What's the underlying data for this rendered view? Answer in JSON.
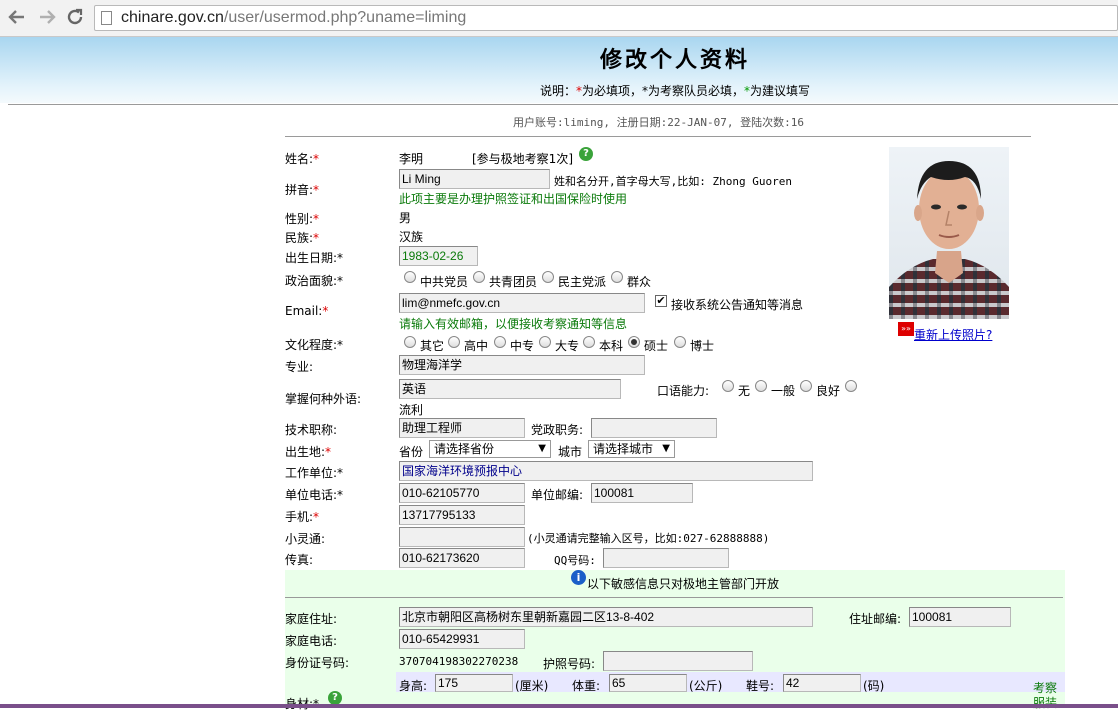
{
  "browser": {
    "url_host": "chinare.gov.cn",
    "url_path": "/user/usermod.php?uname=liming",
    "back_icon": "arrow-left-icon",
    "forward_icon": "arrow-right-icon",
    "reload_icon": "reload-icon"
  },
  "header": {
    "title": "修改个人资料",
    "legend_prefix": "说明：",
    "legend_req": "为必填项，",
    "legend_team": "为考察队员必填，",
    "legend_suggest": "为建议填写",
    "star": "*"
  },
  "account_info": "用户账号:liming, 注册日期:22-JAN-07, 登陆次数:16",
  "form": {
    "name_label": "姓名:",
    "name_value": "李明",
    "expedition": "[参与极地考察1次]",
    "pinyin_label": "拼音:",
    "pinyin_value": "Li Ming",
    "pinyin_hint": "姓和名分开,首字母大写,比如: Zhong Guoren",
    "pinyin_note": "此项主要是办理护照签证和出国保险时使用",
    "gender_label": "性别:",
    "gender_value": "男",
    "ethnic_label": "民族:",
    "ethnic_value": "汉族",
    "birth_label": "出生日期:",
    "birth_value": "1983-02-26",
    "political_label": "政治面貌:",
    "political_options": [
      "中共党员",
      "共青团员",
      "民主党派",
      "群众"
    ],
    "email_label": "Email:",
    "email_value": "lim@nmefc.gov.cn",
    "email_checkbox": "接收系统公告通知等消息",
    "email_note": "请输入有效邮箱，以便接收考察通知等信息",
    "edu_label": "文化程度:",
    "edu_options": [
      "其它",
      "高中",
      "中专",
      "大专",
      "本科",
      "硕士",
      "博士"
    ],
    "edu_selected": "硕士",
    "major_label": "专业:",
    "major_value": "物理海洋学",
    "lang_label": "掌握何种外语:",
    "lang_value": "英语",
    "oral_label": "口语能力:",
    "oral_options": [
      "无",
      "一般",
      "良好",
      "流利"
    ],
    "title_label": "技术职称:",
    "title_value": "助理工程师",
    "party_label": "党政职务:",
    "party_value": "",
    "birthplace_label": "出生地:",
    "province_label": "省份",
    "province_value": "请选择省份",
    "city_label": "城市",
    "city_value": "请选择城市",
    "work_label": "工作单位:",
    "work_value": "国家海洋环境预报中心",
    "workphone_label": "单位电话:",
    "workphone_value": "010-62105770",
    "workzip_label": "单位邮编:",
    "workzip_value": "100081",
    "mobile_label": "手机:",
    "mobile_value": "13717795133",
    "phs_label": "小灵通:",
    "phs_value": "",
    "phs_hint": "(小灵通请完整输入区号，比如:027-62888888)",
    "fax_label": "传真:",
    "fax_value": "010-62173620",
    "qq_label": "QQ号码:",
    "qq_value": "",
    "sensitive_note": "以下敏感信息只对极地主管部门开放",
    "home_label": "家庭住址:",
    "home_value": "北京市朝阳区高杨树东里朝新嘉园二区13-8-402",
    "homezip_label": "住址邮编:",
    "homezip_value": "100081",
    "homephone_label": "家庭电话:",
    "homephone_value": "010-65429931",
    "id_label": "身份证号码:",
    "id_value": "370704198302270238",
    "passport_label": "护照号码:",
    "passport_value": "",
    "body_label": "身材:",
    "height_label": "身高:",
    "height_value": "175",
    "height_unit": "(厘米)",
    "weight_label": "体重:",
    "weight_value": "65",
    "weight_unit": "(公斤)",
    "shoe_label": "鞋号:",
    "shoe_value": "42",
    "shoe_unit": "(码)",
    "side_note_1": "考察",
    "side_note_2": "服装"
  },
  "photo": {
    "reupload_link": "重新上传照片?"
  }
}
